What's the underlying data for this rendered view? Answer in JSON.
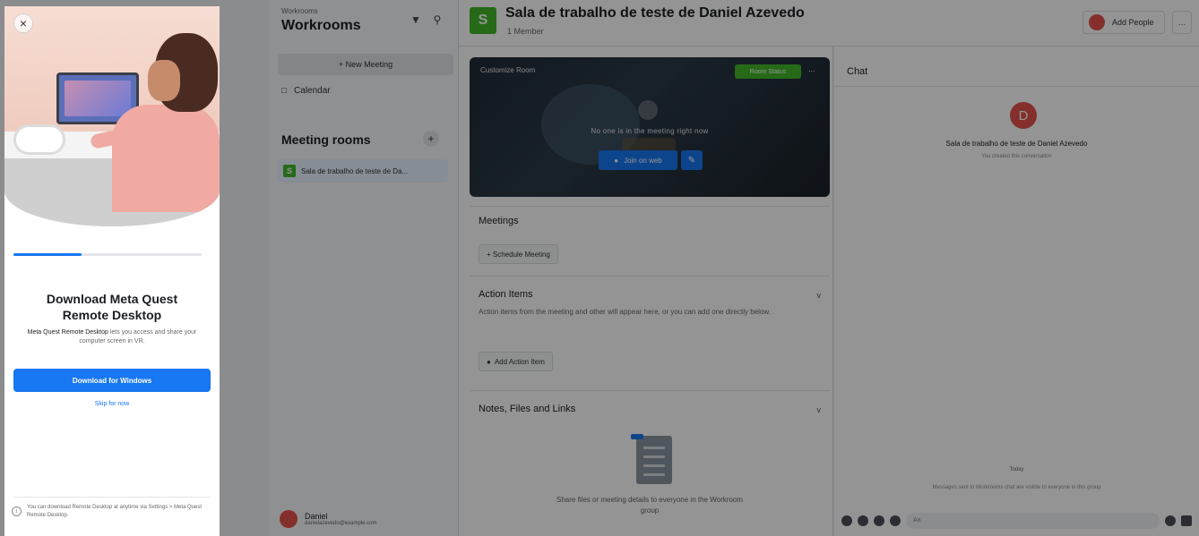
{
  "sidebar": {
    "workspace_caption": "Workrooms",
    "workspace_title": "Workrooms",
    "bell_icon": "bell-icon",
    "search_icon": "search-icon",
    "new_meeting": "+ New Meeting",
    "calendar": "Calendar",
    "meeting_rooms_title": "Meeting rooms",
    "meeting_rooms_add": "+",
    "room_avatar": "S",
    "room_name": "Sala de trabalho de teste de Da...",
    "user_name": "Daniel",
    "user_email": "danielazevedo@example.com"
  },
  "header": {
    "avatar_letter": "S",
    "title": "Sala de trabalho de teste de Daniel Azevedo",
    "subtitle": "1 Member",
    "add_people": "Add People",
    "more": "..."
  },
  "room_preview": {
    "customize": "Customize Room",
    "status_button": "Room Status",
    "more": "...",
    "status_text": "No one is in the meeting right now",
    "join_label": "Join on web",
    "edit_icon": "pencil-icon"
  },
  "meetings": {
    "title": "Meetings",
    "schedule": "+ Schedule Meeting"
  },
  "action_items": {
    "title": "Action Items",
    "description": "Action items from the meeting and other will appear here, or you can add one directly below.",
    "add": "Add Action Item",
    "chevron": "v"
  },
  "notes": {
    "title": "Notes, Files and Links",
    "chevron": "v",
    "empty": "Share files or meeting details to everyone in the Workroom group"
  },
  "chat": {
    "title": "Chat",
    "avatar_letter": "D",
    "room_name": "Sala de trabalho de teste de Daniel Azevedo",
    "room_sub": "You created this conversation",
    "today": "Today",
    "info": "Messages sent in Workrooms chat are visible to everyone in this group",
    "placeholder": "Aa"
  },
  "panel": {
    "close": "×",
    "progress": 0.36,
    "title_line1": "Download Meta Quest",
    "title_line2": "Remote Desktop",
    "desc_bold": "Meta Quest Remote Desktop",
    "desc_rest": " lets you access and share your computer screen in VR.",
    "download": "Download for Windows",
    "skip": "Skip for now",
    "footer": "You can download Remote Desktop at anytime via Settings > Meta Quest Remote Desktop."
  },
  "colors": {
    "accent": "#1877f2",
    "room_green": "#42b72a",
    "avatar_red": "#e4524a"
  }
}
